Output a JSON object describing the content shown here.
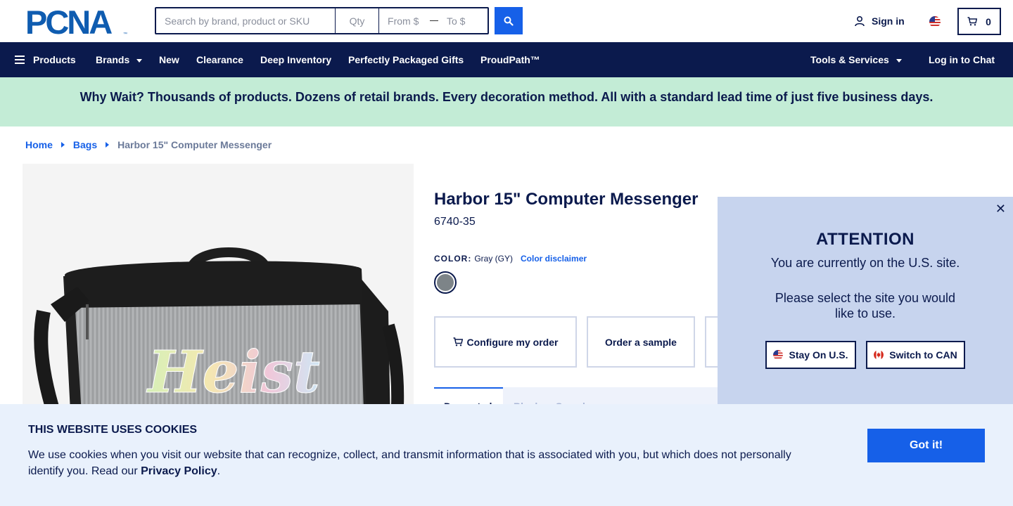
{
  "header": {
    "logo_text": "PCNA",
    "search": {
      "placeholder": "Search by brand, product or SKU",
      "qty_placeholder": "Qty",
      "from_placeholder": "From $",
      "to_placeholder": "To $"
    },
    "sign_in_label": "Sign in",
    "cart_count": "0"
  },
  "nav": {
    "products": "Products",
    "brands": "Brands",
    "new": "New",
    "clearance": "Clearance",
    "deep_inventory": "Deep Inventory",
    "gifts": "Perfectly Packaged Gifts",
    "proudpath": "ProudPath™",
    "tools": "Tools & Services",
    "chat": "Log in to Chat"
  },
  "banner": {
    "text": "Why Wait? Thousands of products. Dozens of retail brands. Every decoration method. All with a standard lead time of just five business days."
  },
  "breadcrumb": {
    "home": "Home",
    "bags": "Bags",
    "current": "Harbor 15\" Computer Messenger"
  },
  "product": {
    "title": "Harbor 15\" Computer Messenger",
    "sku": "6740-35",
    "color_label": "COLOR:",
    "color_value": "Gray (GY)",
    "color_disclaimer": "Color disclaimer",
    "swatch_color": "#7d8488",
    "configure_label": "Configure my order",
    "sample_label": "Order a sample",
    "tab_active": "Decorated",
    "tab_2": "Blank or Sample",
    "image_text": "Heist"
  },
  "modal": {
    "title": "ATTENTION",
    "message1": "You are currently on the U.S. site.",
    "message2": "Please select the site you would like to use.",
    "stay_label": "Stay On U.S.",
    "switch_label": "Switch to CAN",
    "close_symbol": "✕"
  },
  "cookie": {
    "title": "THIS WEBSITE USES COOKIES",
    "text": "We use cookies when you visit our website that can recognize, collect, and transmit information that is associated with you, but which does not personally identify you. Read our ",
    "link": "Privacy Policy",
    "period": ".",
    "button": "Got it!"
  },
  "colors": {
    "navy": "#0b1a4d",
    "blue": "#1660e8",
    "banner_bg": "#c3ecd6",
    "modal_bg": "#c7d4ee",
    "cookie_bg": "#e9f1fc"
  }
}
